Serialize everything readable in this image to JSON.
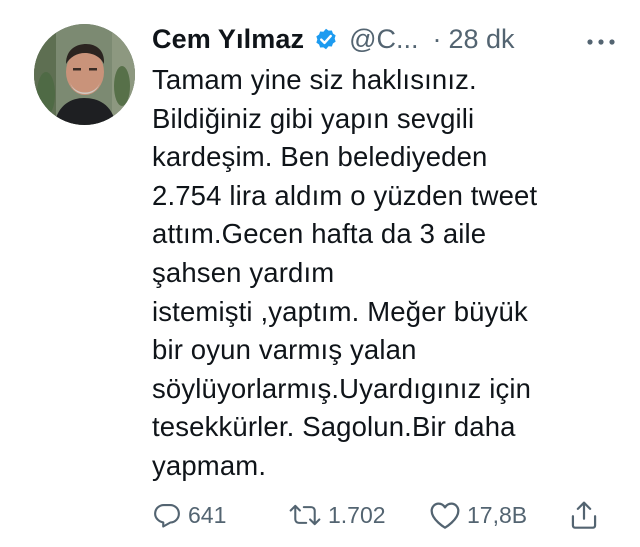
{
  "tweet": {
    "author_name": "Cem Yılmaz",
    "handle": "@C...",
    "separator": "·",
    "time": "28 dk",
    "verified_icon": "verified-badge-icon",
    "more_icon": "more-options-icon",
    "accent_color": "#1d9bf0",
    "text_lines": [
      "Tamam yine siz haklısınız.",
      "Bildiğiniz gibi yapın sevgili",
      "kardeşim. Ben belediyeden",
      "2.754 lira aldım o yüzden tweet",
      "attım.Gecen hafta da 3  aile",
      "şahsen yardım",
      "istemişti ,yaptım. Meğer büyük",
      "bir oyun varmış yalan",
      "söylüyorlarmış.Uyardıgınız için",
      "tesekkürler. Sagolun.Bir daha",
      "yapmam."
    ]
  },
  "actions": {
    "reply": {
      "icon": "reply-icon",
      "count": "641"
    },
    "retweet": {
      "icon": "retweet-icon",
      "count": "1.702"
    },
    "like": {
      "icon": "heart-icon",
      "count": "17,8B"
    },
    "share": {
      "icon": "share-icon"
    }
  }
}
